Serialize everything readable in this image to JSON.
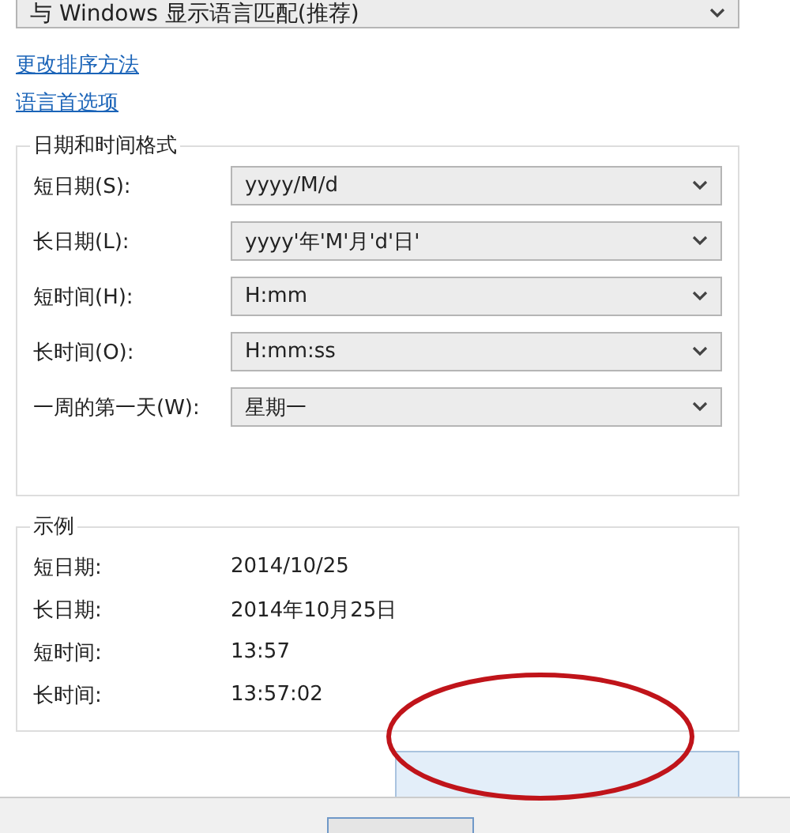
{
  "top_dropdown": {
    "value": "与 Windows 显示语言匹配(推荐)"
  },
  "links": [
    "更改排序方法",
    "语言首选项"
  ],
  "formats": {
    "title": "日期和时间格式",
    "rows": [
      {
        "label": "短日期(S):",
        "value": "yyyy/M/d"
      },
      {
        "label": "长日期(L):",
        "value": "yyyy'年'M'月'd'日'"
      },
      {
        "label": "短时间(H):",
        "value": "H:mm"
      },
      {
        "label": "长时间(O):",
        "value": "H:mm:ss"
      },
      {
        "label": "一周的第一天(W):",
        "value": "星期一"
      }
    ]
  },
  "examples": {
    "title": "示例",
    "rows": [
      {
        "label": "短日期:",
        "value": "2014/10/25"
      },
      {
        "label": "长日期:",
        "value": "2014年10月25日"
      },
      {
        "label": "短时间:",
        "value": "13:57"
      },
      {
        "label": "长时间:",
        "value": "13:57:02"
      }
    ]
  }
}
